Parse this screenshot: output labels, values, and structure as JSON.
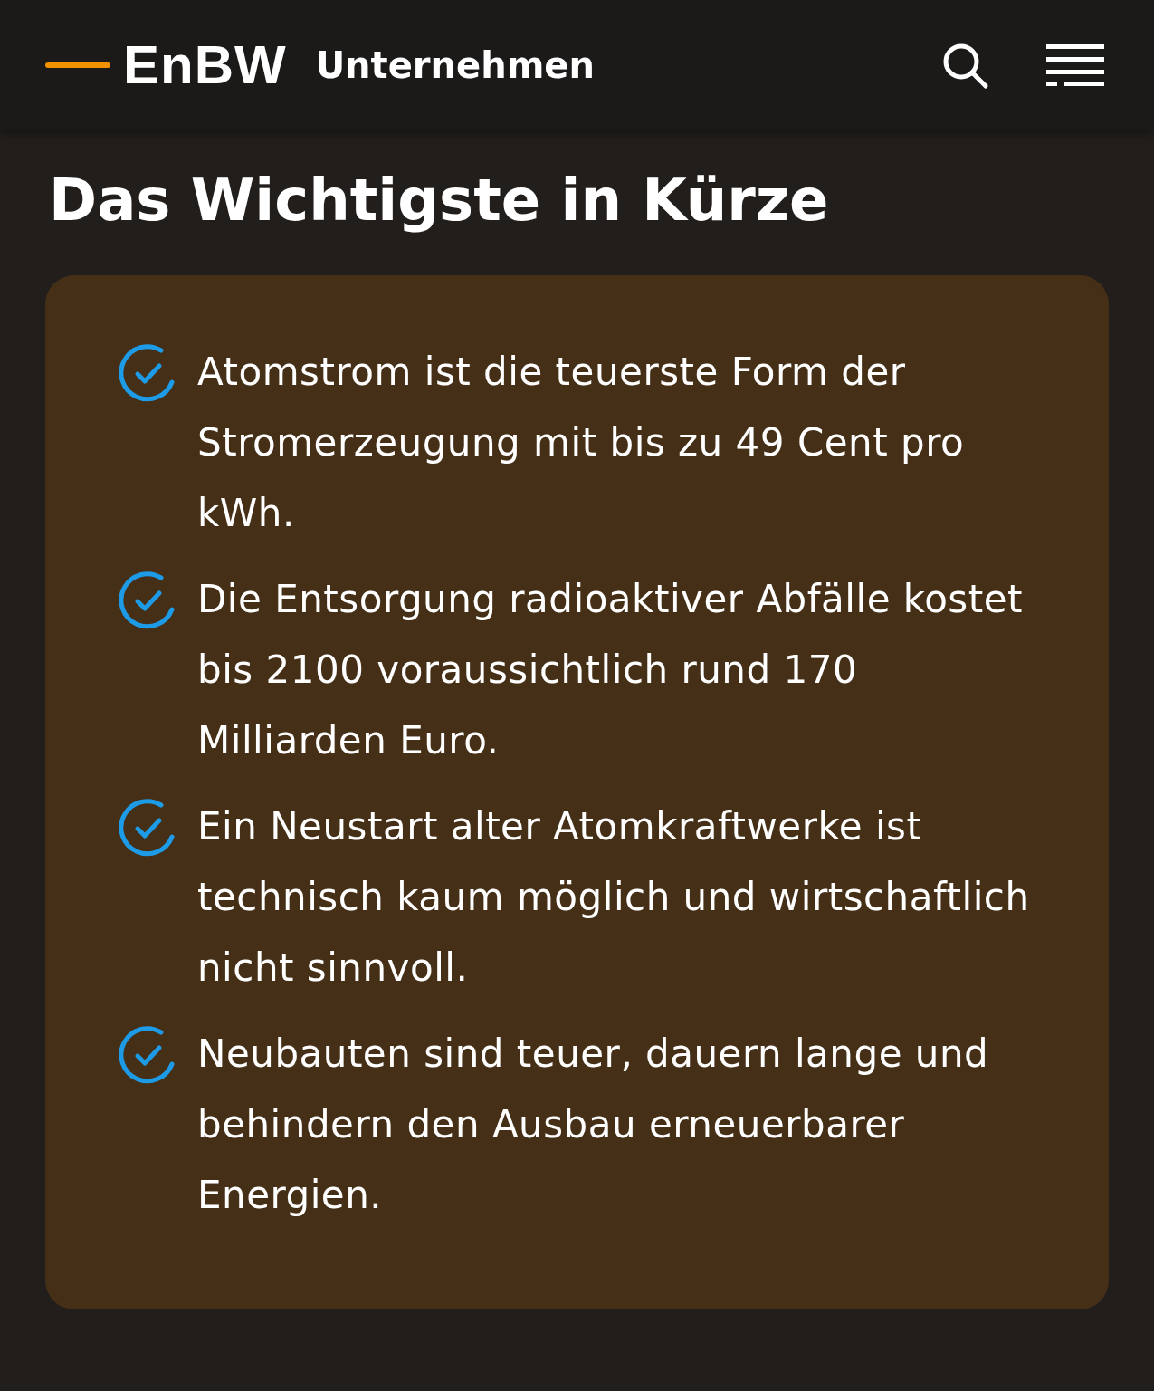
{
  "header": {
    "logo": "EnBW",
    "section": "Unternehmen"
  },
  "title": "Das Wichtigste in Kürze",
  "summary": {
    "items": [
      {
        "text": "Atomstrom ist die teuerste Form der Stromerzeugung mit bis zu 49 Cent pro kWh."
      },
      {
        "text": "Die Entsorgung radioaktiver Abfälle kostet bis 2100 voraussichtlich rund 170 Milliarden Euro."
      },
      {
        "text": "Ein Neustart alter Atomkraftwerke ist technisch kaum möglich und wirtschaftlich nicht sinnvoll."
      },
      {
        "text": "Neubauten sind teuer, dauern lange und behindern den Ausbau erneuerbarer Energien."
      }
    ]
  }
}
